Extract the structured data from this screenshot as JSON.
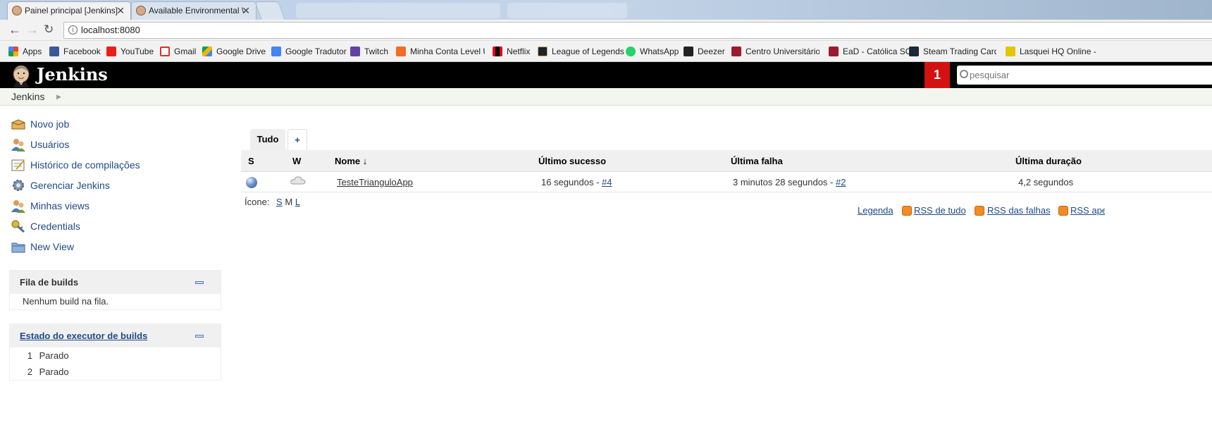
{
  "browser": {
    "tabs": [
      {
        "title": "Painel principal [Jenkins]",
        "active": true
      },
      {
        "title": "Available Environmental \\",
        "active": false
      }
    ],
    "url": "localhost:8080",
    "bookmarks": [
      {
        "label": "Apps",
        "icon": "apps-grid-icon",
        "color": "#e0453a"
      },
      {
        "label": "Facebook",
        "icon": "facebook-icon",
        "color": "#3b5998"
      },
      {
        "label": "YouTube",
        "icon": "youtube-icon",
        "color": "#e62117"
      },
      {
        "label": "Gmail",
        "icon": "gmail-icon",
        "color": "#d93025"
      },
      {
        "label": "Google Drive",
        "icon": "google-drive-icon",
        "color": "#f4b400"
      },
      {
        "label": "Google Tradutor",
        "icon": "google-translate-icon",
        "color": "#4285f4"
      },
      {
        "label": "Twitch",
        "icon": "twitch-icon",
        "color": "#6441a5"
      },
      {
        "label": "Minha Conta Level Up",
        "icon": "levelup-icon",
        "color": "#f26c23"
      },
      {
        "label": "Netflix",
        "icon": "netflix-icon",
        "color": "#e50914"
      },
      {
        "label": "League of Legends",
        "icon": "lol-icon",
        "color": "#1e2328"
      },
      {
        "label": "WhatsApp",
        "icon": "whatsapp-icon",
        "color": "#25d366"
      },
      {
        "label": "Deezer",
        "icon": "deezer-icon",
        "color": "#222222"
      },
      {
        "label": "Centro Universitário -",
        "icon": "university-icon",
        "color": "#9b1c2e"
      },
      {
        "label": "EaD - Católica SC",
        "icon": "ead-icon",
        "color": "#9b1c2e"
      },
      {
        "label": "Steam Trading Cards",
        "icon": "steam-icon",
        "color": "#1b2838"
      },
      {
        "label": "Lasquei HQ Online -",
        "icon": "lasquei-icon",
        "color": "#e3c500"
      }
    ]
  },
  "header": {
    "title": "Jenkins",
    "notifications": "1",
    "search_placeholder": "pesquisar"
  },
  "breadcrumb": {
    "root": "Jenkins"
  },
  "sidebar": {
    "tasks": [
      {
        "label": "Novo job",
        "icon": "new-job-icon"
      },
      {
        "label": "Usuários",
        "icon": "users-icon"
      },
      {
        "label": "Histórico de compilações",
        "icon": "build-history-icon"
      },
      {
        "label": "Gerenciar Jenkins",
        "icon": "gear-icon"
      },
      {
        "label": "Minhas views",
        "icon": "my-views-icon"
      },
      {
        "label": "Credentials",
        "icon": "credentials-icon"
      },
      {
        "label": "New View",
        "icon": "new-view-icon"
      }
    ],
    "queue": {
      "title": "Fila de builds",
      "empty": "Nenhum build na fila."
    },
    "executors": {
      "title": "Estado do executor de builds",
      "rows": [
        {
          "num": "1",
          "status": "Parado"
        },
        {
          "num": "2",
          "status": "Parado"
        }
      ]
    }
  },
  "main": {
    "view_tabs": {
      "active": "Tudo",
      "add": "+"
    },
    "columns": {
      "s": "S",
      "w": "W",
      "name": "Nome ↓",
      "last_success": "Último sucesso",
      "last_failure": "Última falha",
      "last_duration": "Última duração"
    },
    "jobs": [
      {
        "status": "blue-ball",
        "weather": "cloudy",
        "name": "TesteTrianguloApp",
        "last_success_time": "16 segundos - ",
        "last_success_build": "#4",
        "last_failure_time": "3 minutos 28 segundos - ",
        "last_failure_build": "#2",
        "last_duration": "4,2 segundos"
      }
    ],
    "icon_size": {
      "label": "Ícone:",
      "s": "S",
      "m": "M",
      "l": "L"
    },
    "footer_links": {
      "legend": "Legenda",
      "rss_all": "RSS de tudo",
      "rss_failures": "RSS das falhas",
      "rss_latest": "RSS ape"
    }
  }
}
